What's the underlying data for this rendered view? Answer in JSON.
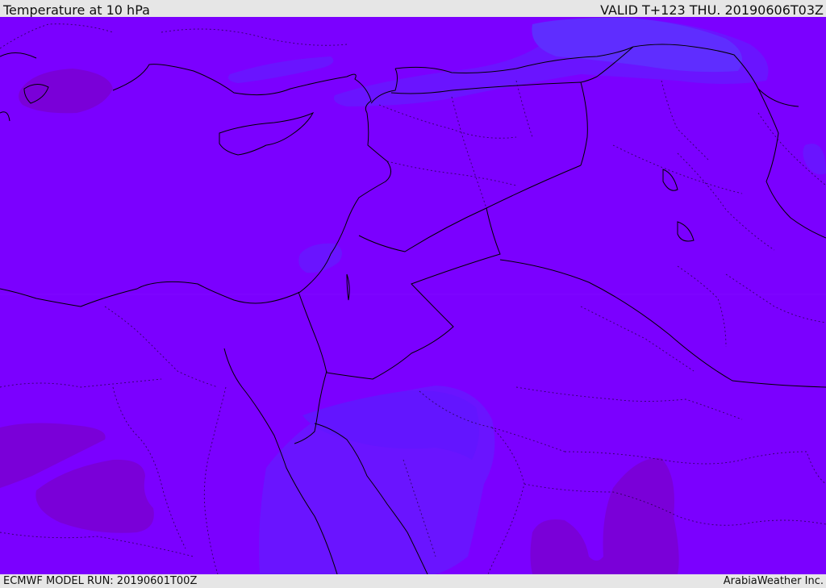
{
  "header": {
    "title": "Temperature at 10 hPa",
    "valid": "VALID T+123 THU. 20190606T03Z"
  },
  "footer": {
    "model_run": "ECMWF MODEL RUN: 20190601T00Z",
    "credit": "ArabiaWeather Inc."
  },
  "map": {
    "region": "Eastern Mediterranean / Middle East",
    "colors": {
      "base_field": "#7b00ff",
      "warm_field": "#6a14ff",
      "warmer_field": "#5f2dff",
      "cool_field": "#7a00d8",
      "coastline": "#000000",
      "borders": "#1a0033"
    }
  }
}
